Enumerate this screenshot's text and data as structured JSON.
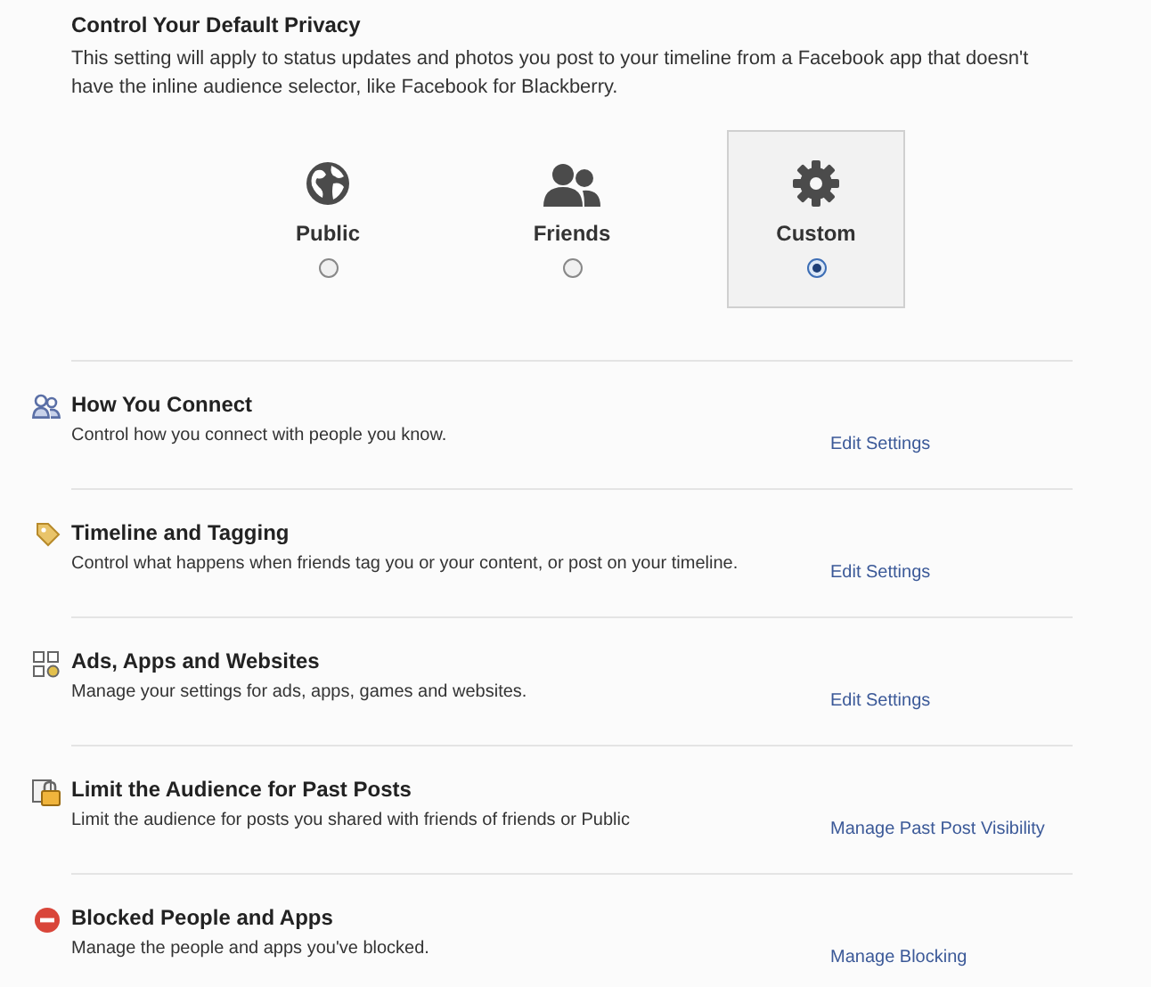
{
  "privacy": {
    "title": "Control Your Default Privacy",
    "description": "This setting will apply to status updates and photos you post to your timeline from a Facebook app that doesn't have the inline audience selector, like Facebook for Blackberry.",
    "options": [
      {
        "kind": "globe",
        "label": "Public",
        "selected": false
      },
      {
        "kind": "people",
        "label": "Friends",
        "selected": false
      },
      {
        "kind": "gear",
        "label": "Custom",
        "selected": true
      }
    ]
  },
  "sections": [
    {
      "kind": "people",
      "title": "How You Connect",
      "description": "Control how you connect with people you know.",
      "link": "Edit Settings"
    },
    {
      "kind": "tag",
      "title": "Timeline and Tagging",
      "description": "Control what happens when friends tag you or your content, or post on your timeline.",
      "link": "Edit Settings"
    },
    {
      "kind": "apps",
      "title": "Ads, Apps and Websites",
      "description": "Manage your settings for ads, apps, games and websites.",
      "link": "Edit Settings"
    },
    {
      "kind": "lock",
      "title": "Limit the Audience for Past Posts",
      "description": "Limit the audience for posts you shared with friends of friends or Public",
      "link": "Manage Past Post Visibility"
    },
    {
      "kind": "blocked",
      "title": "Blocked People and Apps",
      "description": "Manage the people and apps you've blocked.",
      "link": "Manage Blocking"
    }
  ]
}
